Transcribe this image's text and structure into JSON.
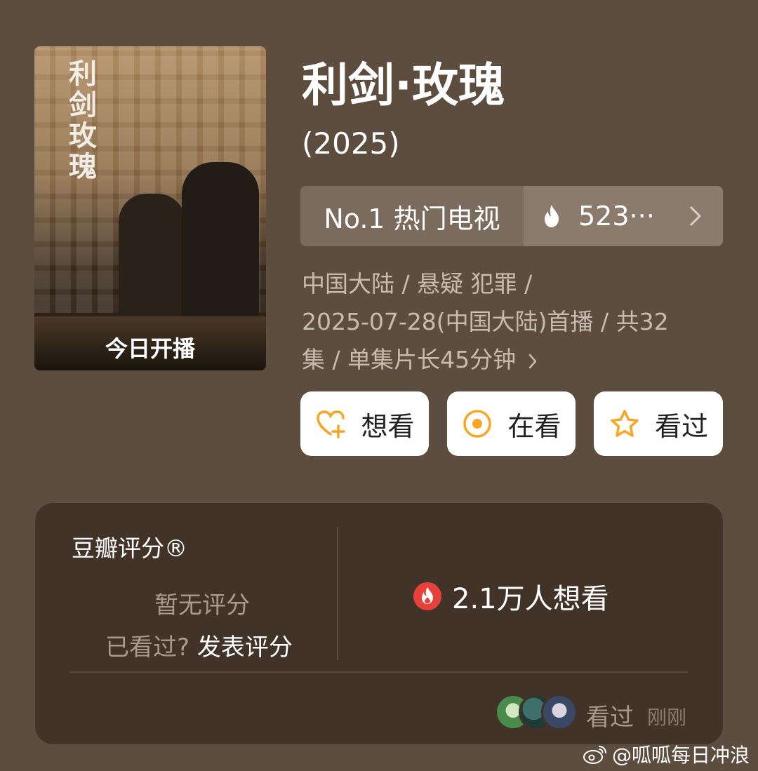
{
  "poster": {
    "title_chars": "利剑玫瑰",
    "tag": "今日开播"
  },
  "header": {
    "title": "利剑·玫瑰",
    "year": "(2025)"
  },
  "rank": {
    "label": "No.1 热门电视",
    "heat": "523···"
  },
  "meta": {
    "line1": "中国大陆 / 悬疑 犯罪 /",
    "line2": "2025-07-28(中国大陆)首播 / 共32",
    "line3": "集 / 单集片长45分钟"
  },
  "actions": {
    "want": "想看",
    "watching": "在看",
    "watched": "看过"
  },
  "rating": {
    "label": "豆瓣评分®",
    "no_score": "暂无评分",
    "seen_prompt": "已看过?",
    "rate_link": "发表评分",
    "wish_count": "2.1万人想看",
    "recent_watched": "看过",
    "recent_time": "刚刚"
  },
  "watermark": {
    "text": "@呱呱每日冲浪"
  },
  "colors": {
    "accent_orange": "#f5a623",
    "fire_red": "#e8413c",
    "background": "#5d4d3e"
  }
}
